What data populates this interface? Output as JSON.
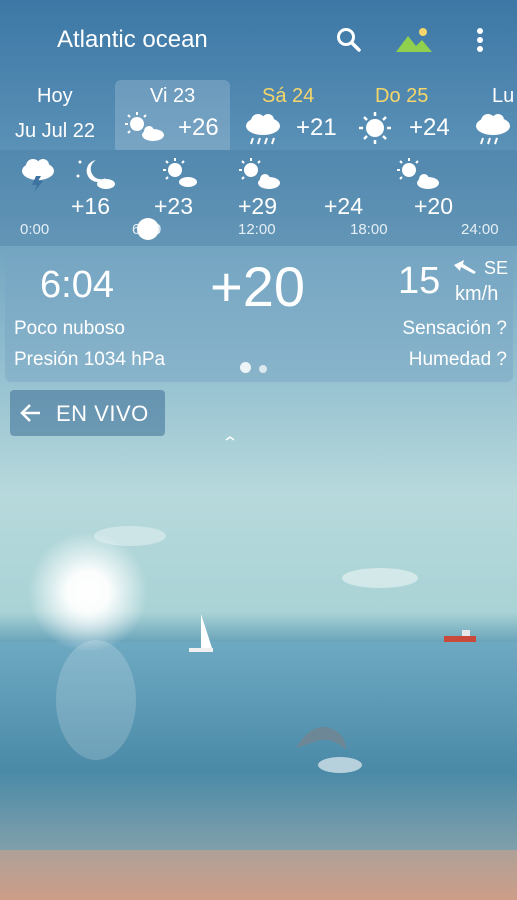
{
  "header": {
    "location_title": "Atlantic ocean",
    "icons": [
      "search-icon",
      "landscape-icon",
      "more-vert-icon"
    ]
  },
  "daily": [
    {
      "name": "Hoy",
      "date": "Ju Jul 22",
      "temp": "",
      "icon": "",
      "selected": false,
      "name_color": "#ffffff"
    },
    {
      "name": "Vi 23",
      "temp": "+26",
      "icon": "sun-cloud-icon",
      "selected": true,
      "name_color": "#ffffff"
    },
    {
      "name": "Sá 24",
      "temp": "+21",
      "icon": "rain-cloud-icon",
      "selected": false,
      "name_color": "#f5d66a"
    },
    {
      "name": "Do 25",
      "temp": "+24",
      "icon": "sun-icon",
      "selected": false,
      "name_color": "#f5d66a"
    },
    {
      "name": "Lu",
      "temp": "",
      "icon": "rain-cloud-icon",
      "selected": false,
      "name_color": "#ffffff"
    }
  ],
  "hourly": {
    "temps": [
      "+16",
      "+23",
      "+29",
      "+24",
      "+20"
    ],
    "icons": [
      "thunderstorm-icon",
      "moon-cloud-icon",
      "sun-cloud-icon",
      "sun-cloud-icon",
      "sun-cloud-icon",
      "sun-cloud-icon"
    ],
    "labels": [
      "0:00",
      "6:00",
      "12:00",
      "18:00",
      "24:00"
    ]
  },
  "current": {
    "time": "6:04",
    "temperature": "+20",
    "wind_speed": "15",
    "wind_unit": "km/h",
    "wind_dir": "SE",
    "condition": "Poco nuboso",
    "pressure": "Presión 1034 hPa",
    "feels_like": "Sensación ?",
    "humidity": "Humedad ?"
  },
  "live": {
    "label": "EN VIVO"
  },
  "colors": {
    "accent_yellow": "#f5d66a",
    "icon_green": "#8fd14f"
  }
}
